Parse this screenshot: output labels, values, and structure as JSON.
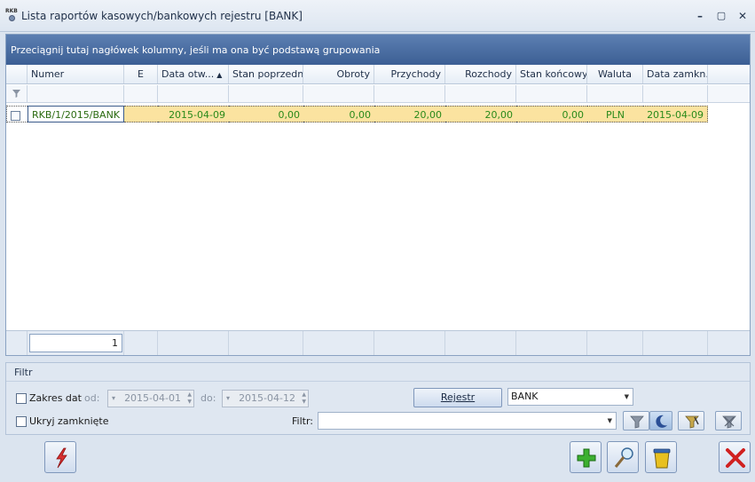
{
  "window": {
    "title": "Lista raportów kasowych/bankowych rejestru [BANK]",
    "app_icon_text": "RKB",
    "minimize": "–",
    "maximize": "▢",
    "close": "✕"
  },
  "grid": {
    "group_hint": "Przeciągnij tutaj nagłówek kolumny, jeśli ma ona być podstawą grupowania",
    "columns": [
      "Numer",
      "E",
      "Data otw...",
      "Stan poprzedni",
      "Obroty",
      "Przychody",
      "Rozchody",
      "Stan końcowy",
      "Waluta",
      "Data zamkn."
    ],
    "sort_indicator": "▲",
    "rows": [
      {
        "numer": "RKB/1/2015/BANK",
        "e": "",
        "data_otw": "2015-04-09",
        "stan_poprzedni": "0,00",
        "obroty": "0,00",
        "przychody": "20,00",
        "rozchody": "20,00",
        "stan_koncowy": "0,00",
        "waluta": "PLN",
        "data_zamkn": "2015-04-09"
      }
    ],
    "footer_count": "1"
  },
  "filter": {
    "section_title": "Filtr",
    "date_range_label": "Zakres dat",
    "from_label": "od:",
    "from_value": "2015-04-01",
    "to_label": "do:",
    "to_value": "2015-04-12",
    "hide_closed_label": "Ukryj zamknięte",
    "register_button": "Rejestr",
    "register_value": "BANK",
    "filter_label": "Filtr:",
    "filter_value": ""
  },
  "colors": {
    "selected_row": "#fbe3a0",
    "row_text": "#2a8a1a",
    "group_panel": "#4a6ea4"
  }
}
